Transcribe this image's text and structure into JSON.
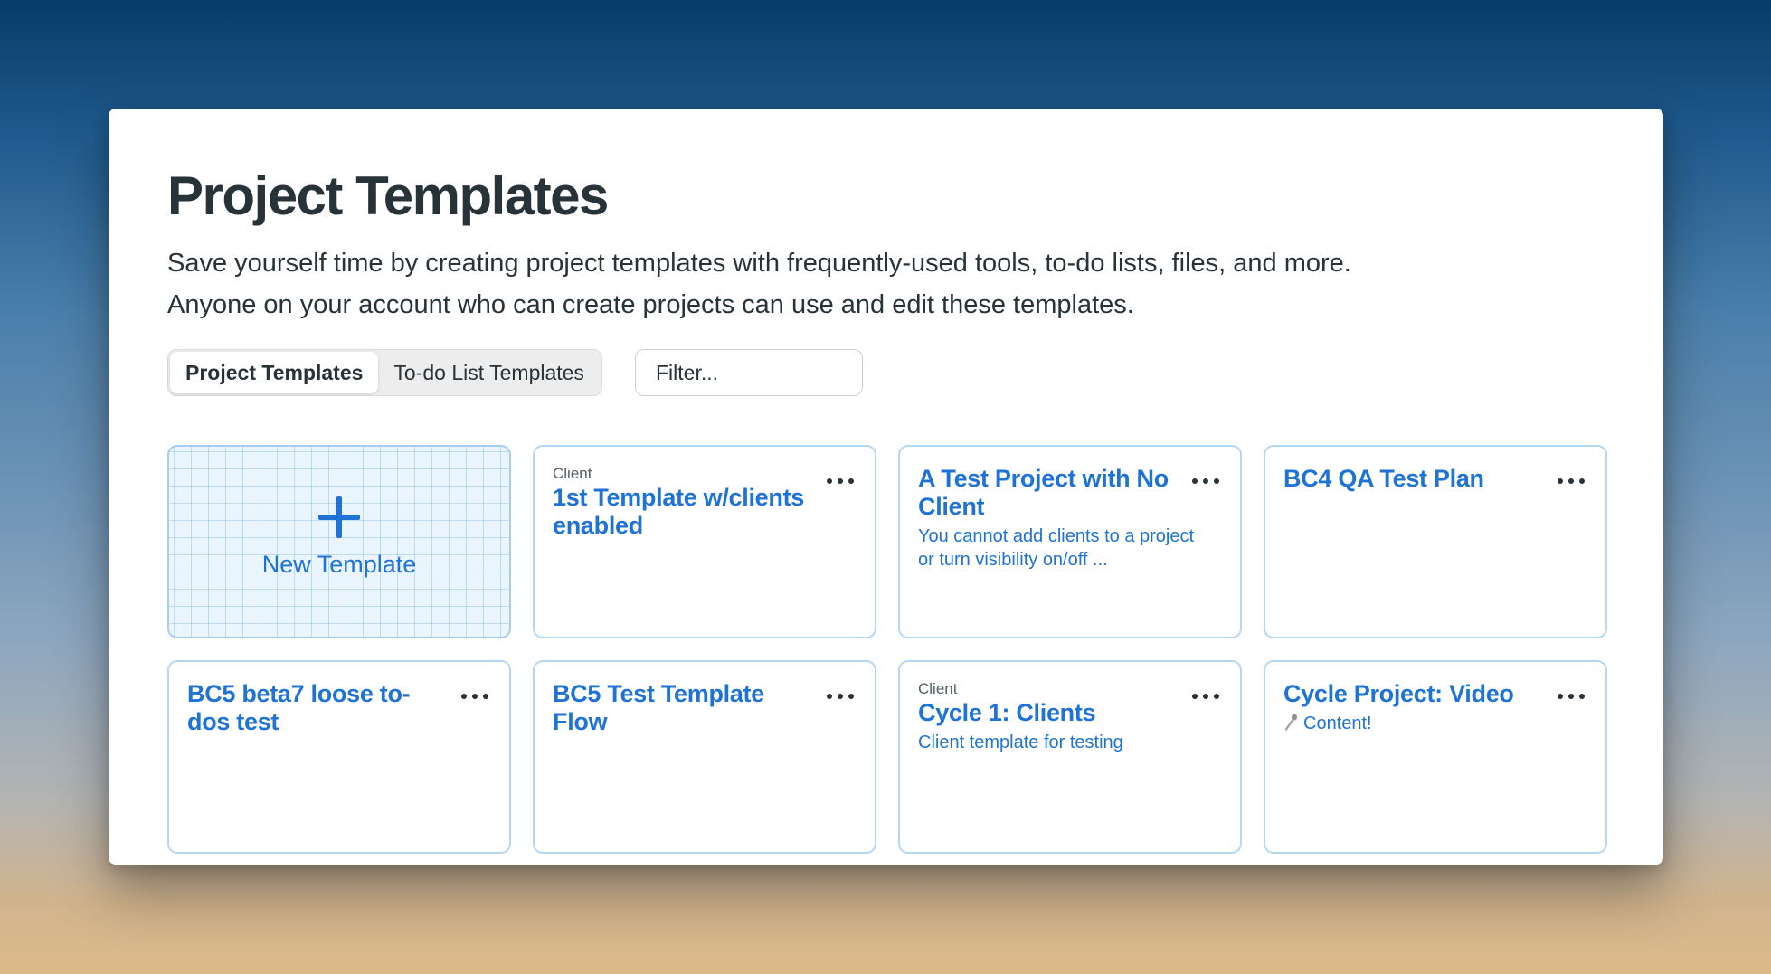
{
  "page": {
    "title": "Project Templates",
    "description": "Save yourself time by creating project templates with frequently-used tools, to-do lists, files, and more. Anyone on your account who can create projects can use and edit these templates."
  },
  "tabs": [
    {
      "label": "Project Templates",
      "active": true
    },
    {
      "label": "To-do List Templates",
      "active": false
    }
  ],
  "filter": {
    "placeholder": "Filter..."
  },
  "new_template": {
    "label": "New Template",
    "icon": "plus-icon"
  },
  "templates": [
    {
      "client": "Client",
      "title": "1st Template w/clients enabled",
      "description": ""
    },
    {
      "client": "",
      "title": "A Test Project with No Client",
      "description": "You cannot add clients to a project or turn visibility on/off ..."
    },
    {
      "client": "",
      "title": "BC4 QA Test Plan",
      "description": ""
    },
    {
      "client": "",
      "title": "BC5 beta7 loose to-dos test",
      "description": ""
    },
    {
      "client": "",
      "title": "BC5 Test Template Flow",
      "description": ""
    },
    {
      "client": "Client",
      "title": "Cycle 1: Clients",
      "description": "Client template for testing"
    },
    {
      "client": "",
      "title": "Cycle Project: Video",
      "description": "Content!",
      "description_icon": "spoon-icon"
    }
  ],
  "colors": {
    "title": "#283239",
    "link": "#1f73d6",
    "card_border": "#b6d7f3",
    "new_template_bg": "#eaf5ff"
  }
}
